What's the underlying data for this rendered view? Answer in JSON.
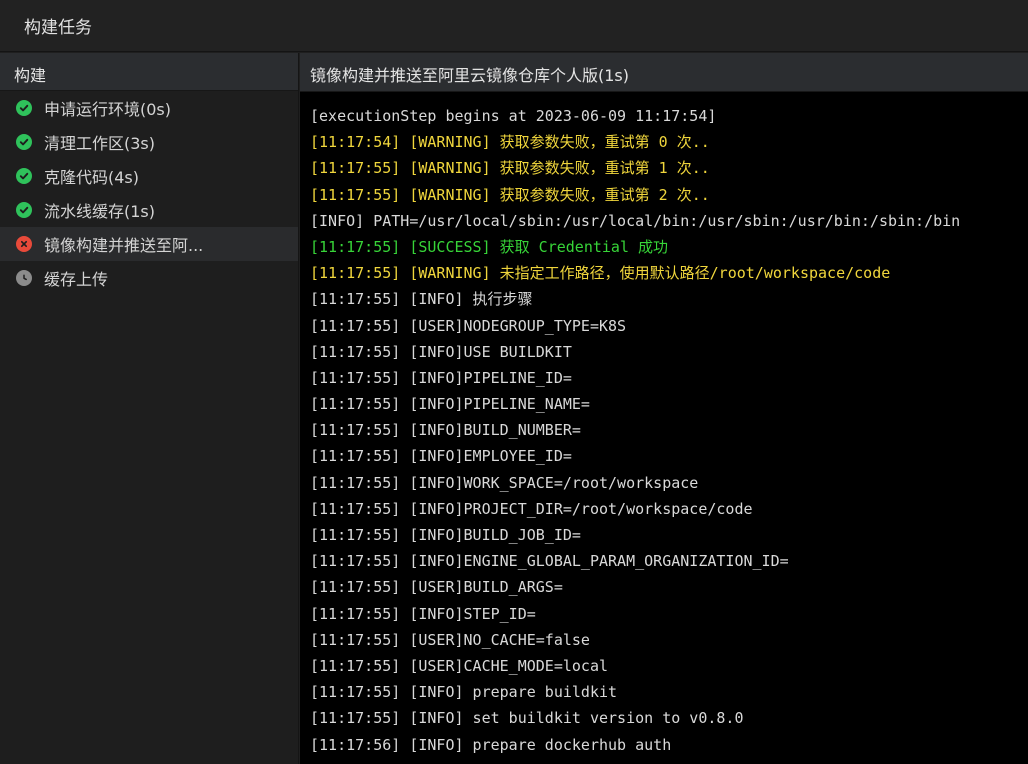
{
  "window": {
    "title": "构建任务"
  },
  "sidebar": {
    "header": "构建",
    "steps": [
      {
        "label": "申请运行环境(0s)",
        "status": "success",
        "icon": "check-circle-icon"
      },
      {
        "label": "清理工作区(3s)",
        "status": "success",
        "icon": "check-circle-icon"
      },
      {
        "label": "克隆代码(4s)",
        "status": "success",
        "icon": "check-circle-icon"
      },
      {
        "label": "流水线缓存(1s)",
        "status": "success",
        "icon": "check-circle-icon"
      },
      {
        "label": "镜像构建并推送至阿...",
        "status": "error",
        "icon": "error-circle-icon"
      },
      {
        "label": "缓存上传",
        "status": "pending",
        "icon": "clock-icon"
      }
    ]
  },
  "main": {
    "header": "镜像构建并推送至阿里云镜像仓库个人版(1s)",
    "log": [
      {
        "text": "[executionStep begins at 2023-06-09 11:17:54]",
        "level": "plain"
      },
      {
        "text": "[11:17:54] [WARNING] 获取参数失败，重试第 0 次..",
        "level": "warning"
      },
      {
        "text": "[11:17:55] [WARNING] 获取参数失败，重试第 1 次..",
        "level": "warning"
      },
      {
        "text": "[11:17:55] [WARNING] 获取参数失败，重试第 2 次..",
        "level": "warning"
      },
      {
        "text": "[INFO] PATH=/usr/local/sbin:/usr/local/bin:/usr/sbin:/usr/bin:/sbin:/bin",
        "level": "plain"
      },
      {
        "text": "[11:17:55] [SUCCESS] 获取 Credential 成功",
        "level": "success"
      },
      {
        "text": "[11:17:55] [WARNING] 未指定工作路径，使用默认路径/root/workspace/code",
        "level": "warning"
      },
      {
        "text": "[11:17:55] [INFO] 执行步骤",
        "level": "plain"
      },
      {
        "text": "[11:17:55] [USER]NODEGROUP_TYPE=K8S",
        "level": "plain"
      },
      {
        "text": "[11:17:55] [INFO]USE BUILDKIT",
        "level": "plain"
      },
      {
        "text": "[11:17:55] [INFO]PIPELINE_ID=",
        "level": "plain"
      },
      {
        "text": "[11:17:55] [INFO]PIPELINE_NAME=",
        "level": "plain"
      },
      {
        "text": "[11:17:55] [INFO]BUILD_NUMBER=",
        "level": "plain"
      },
      {
        "text": "[11:17:55] [INFO]EMPLOYEE_ID=",
        "level": "plain"
      },
      {
        "text": "[11:17:55] [INFO]WORK_SPACE=/root/workspace",
        "level": "plain"
      },
      {
        "text": "[11:17:55] [INFO]PROJECT_DIR=/root/workspace/code",
        "level": "plain"
      },
      {
        "text": "[11:17:55] [INFO]BUILD_JOB_ID=",
        "level": "plain"
      },
      {
        "text": "[11:17:55] [INFO]ENGINE_GLOBAL_PARAM_ORGANIZATION_ID=",
        "level": "plain"
      },
      {
        "text": "[11:17:55] [USER]BUILD_ARGS=",
        "level": "plain"
      },
      {
        "text": "[11:17:55] [INFO]STEP_ID=",
        "level": "plain"
      },
      {
        "text": "[11:17:55] [USER]NO_CACHE=false",
        "level": "plain"
      },
      {
        "text": "[11:17:55] [USER]CACHE_MODE=local",
        "level": "plain"
      },
      {
        "text": "[11:17:55] [INFO] prepare buildkit",
        "level": "plain"
      },
      {
        "text": "[11:17:55] [INFO] set buildkit version to v0.8.0",
        "level": "plain"
      },
      {
        "text": "[11:17:56] [INFO] prepare dockerhub auth",
        "level": "plain"
      }
    ]
  },
  "colors": {
    "success": "#2fc25b",
    "error": "#e84a3a",
    "pending": "#8b8b8b",
    "log_warning": "#f0d63c",
    "log_success": "#37d438",
    "log_plain": "#d9d9d9"
  }
}
